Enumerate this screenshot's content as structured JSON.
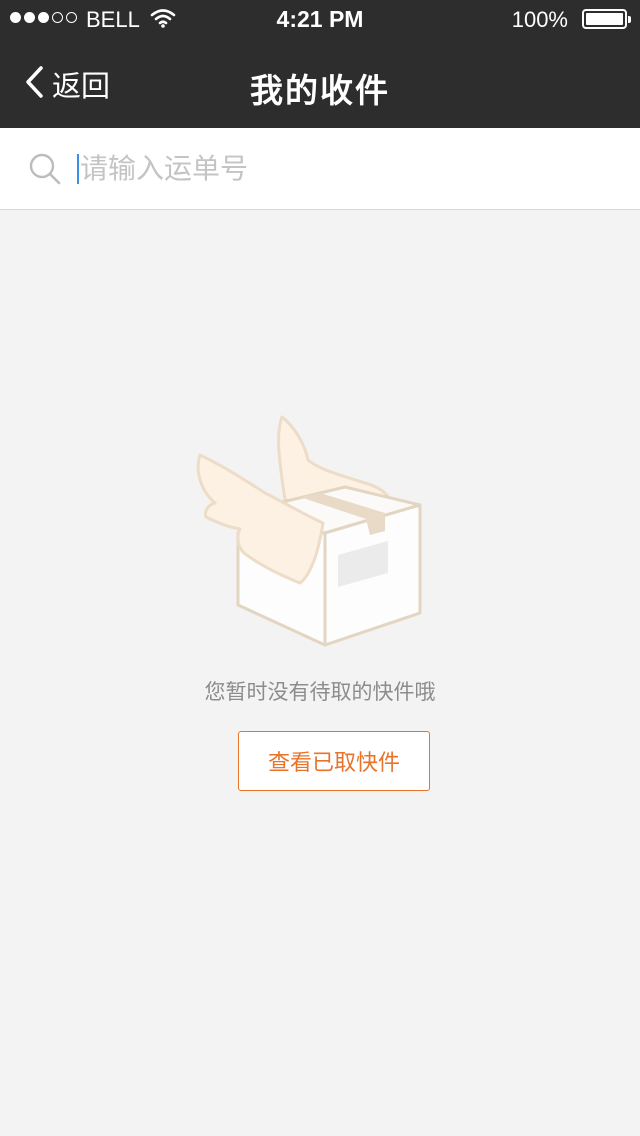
{
  "status_bar": {
    "carrier": "BELL",
    "time": "4:21 PM",
    "battery": "100%",
    "signal_bars": 3,
    "signal_total": 5
  },
  "nav": {
    "back_label": "返回",
    "title": "我的收件"
  },
  "search": {
    "placeholder": "请输入运单号",
    "value": ""
  },
  "empty_state": {
    "message": "您暂时没有待取的快件哦",
    "button_label": "查看已取快件"
  },
  "colors": {
    "header_bg": "#2d2d2d",
    "page_bg": "#f3f3f3",
    "accent": "#e8732a",
    "caret": "#3a8ee6"
  },
  "icons": {
    "back": "chevron-left-icon",
    "search": "search-icon",
    "wifi": "wifi-icon",
    "battery": "battery-icon",
    "illustration": "flying-package-icon"
  }
}
